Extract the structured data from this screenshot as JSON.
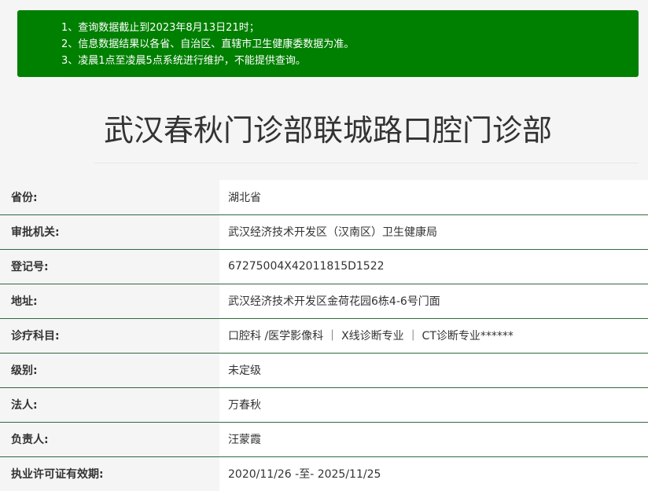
{
  "notice": {
    "lines": [
      "1、查询数据截止到2023年8月13日21时；",
      "2、信息数据结果以各省、自治区、直辖市卫生健康委数据为准。",
      "3、凌晨1点至凌晨5点系统进行维护，不能提供查询。"
    ]
  },
  "title": "武汉春秋门诊部联城路口腔门诊部",
  "info": [
    {
      "label": "省份:",
      "value": "湖北省"
    },
    {
      "label": "审批机关:",
      "value": "武汉经济技术开发区（汉南区）卫生健康局"
    },
    {
      "label": "登记号:",
      "value": "67275004X42011815D1522"
    },
    {
      "label": "地址:",
      "value": "武汉经济技术开发区金荷花园6栋4-6号门面"
    },
    {
      "label": "诊疗科目:",
      "value": "口腔科 /医学影像科 ｜ X线诊断专业 ｜ CT诊断专业******"
    },
    {
      "label": "级别:",
      "value": "未定级"
    },
    {
      "label": "法人:",
      "value": "万春秋"
    },
    {
      "label": "负责人:",
      "value": "汪蒙霞"
    },
    {
      "label": "执业许可证有效期:",
      "value": "2020/11/26 -至- 2025/11/25"
    }
  ]
}
